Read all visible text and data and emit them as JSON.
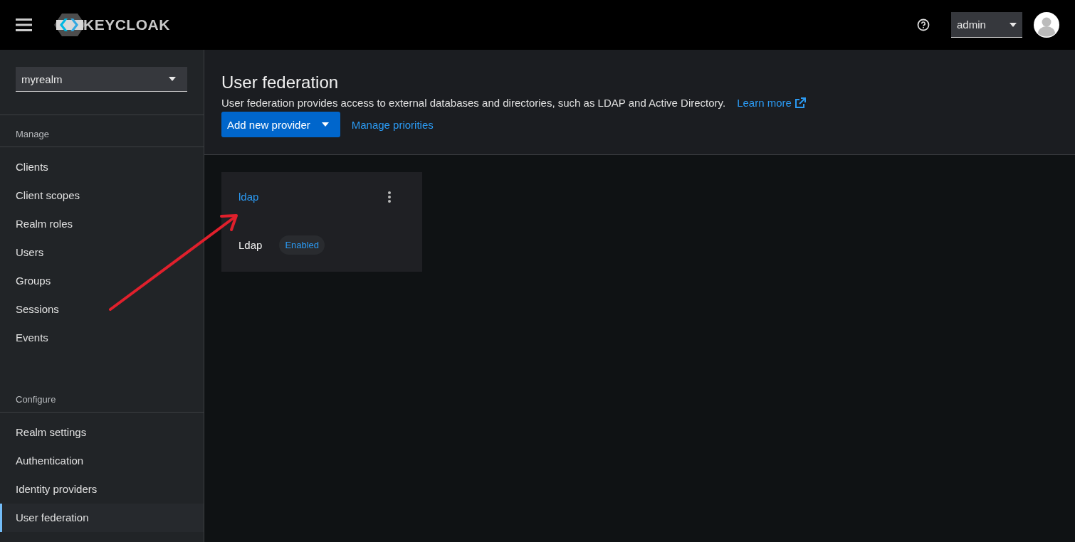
{
  "header": {
    "brand": "KEYCLOAK",
    "user_menu": "admin"
  },
  "sidebar": {
    "realm": "myrealm",
    "sections": [
      {
        "title": "Manage",
        "items": [
          {
            "label": "Clients",
            "selected": false
          },
          {
            "label": "Client scopes",
            "selected": false
          },
          {
            "label": "Realm roles",
            "selected": false
          },
          {
            "label": "Users",
            "selected": false
          },
          {
            "label": "Groups",
            "selected": false
          },
          {
            "label": "Sessions",
            "selected": false
          },
          {
            "label": "Events",
            "selected": false
          }
        ]
      },
      {
        "title": "Configure",
        "items": [
          {
            "label": "Realm settings",
            "selected": false
          },
          {
            "label": "Authentication",
            "selected": false
          },
          {
            "label": "Identity providers",
            "selected": false
          },
          {
            "label": "User federation",
            "selected": true
          }
        ]
      }
    ]
  },
  "page": {
    "title": "User federation",
    "description": "User federation provides access to external databases and directories, such as LDAP and Active Directory.",
    "learn_more": "Learn more",
    "add_button": "Add new provider",
    "manage_link": "Manage priorities"
  },
  "providers": [
    {
      "name": "ldap",
      "type": "Ldap",
      "status": "Enabled"
    }
  ]
}
